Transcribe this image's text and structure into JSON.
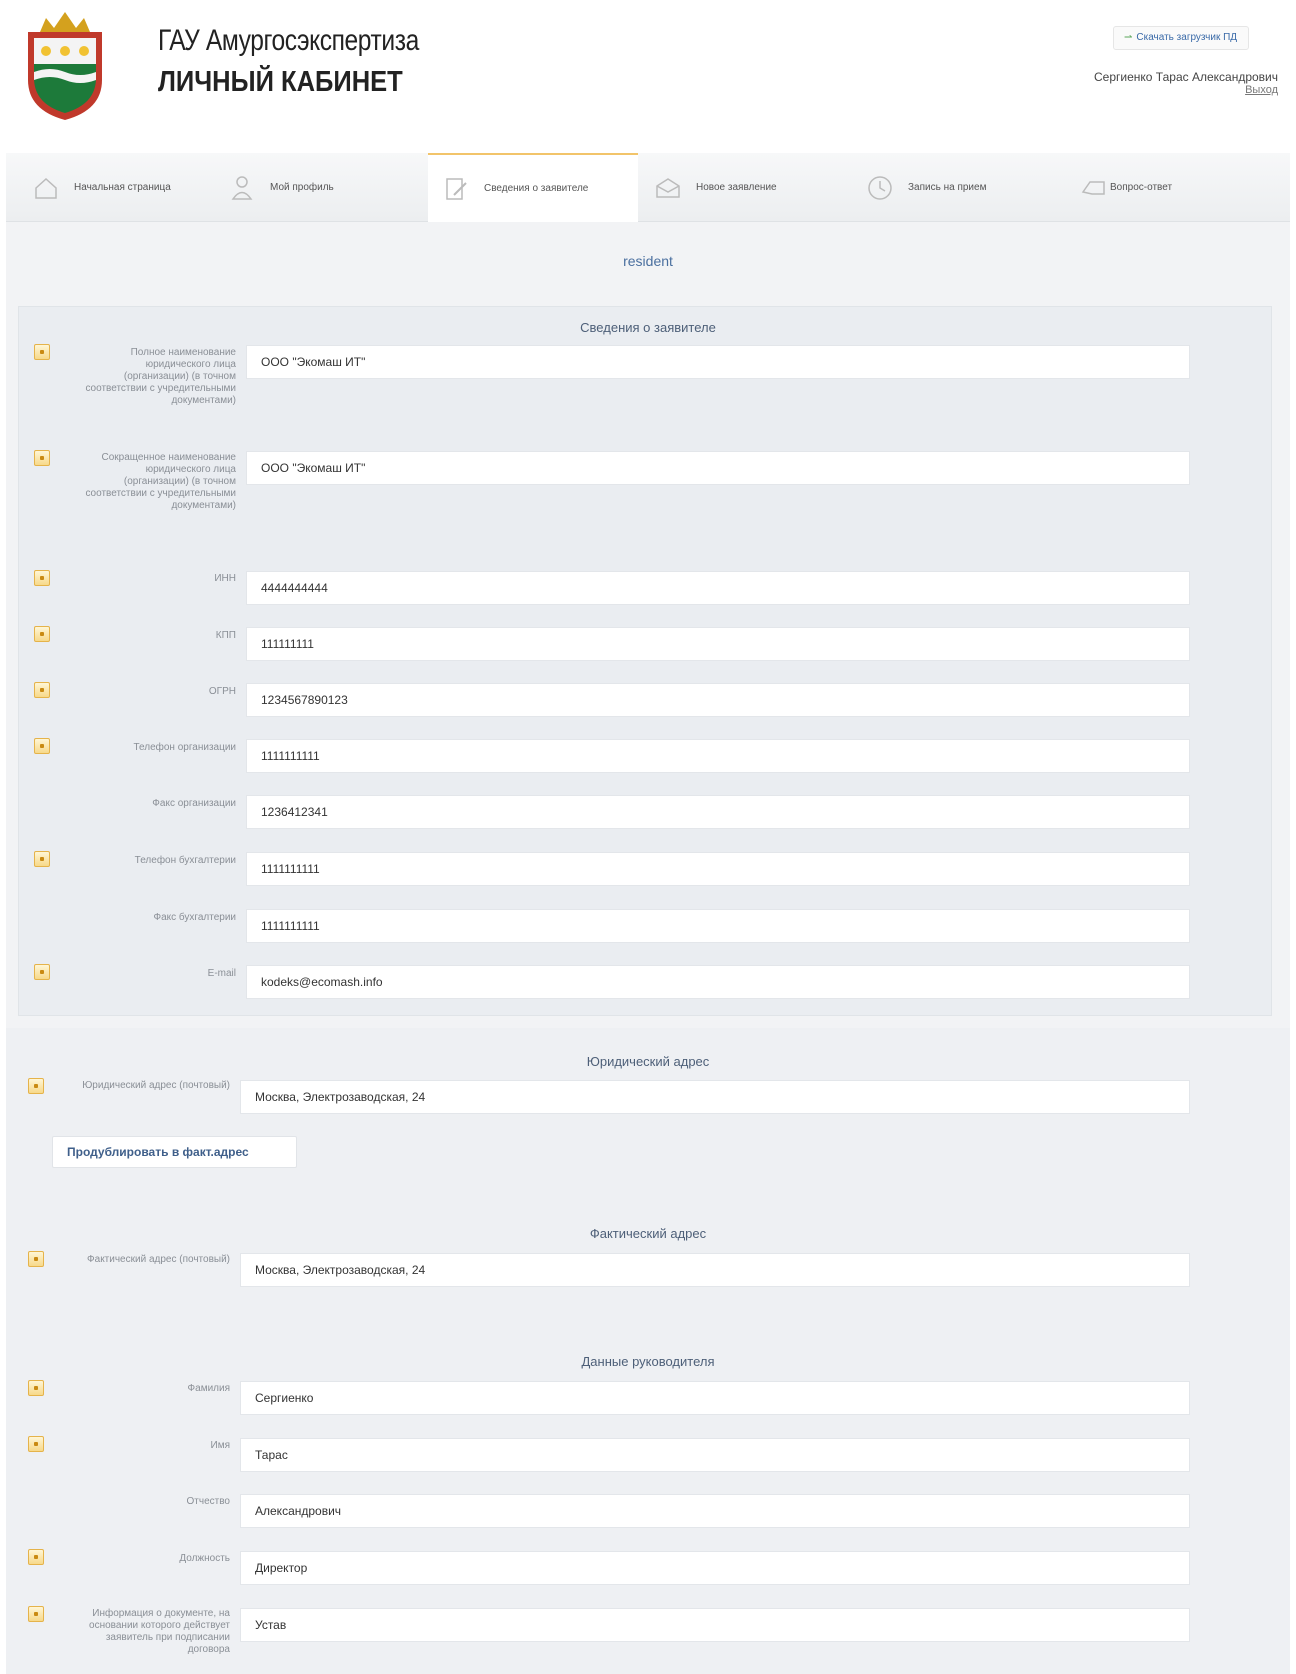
{
  "header": {
    "org_title": "ГАУ Амургосэкспертиза",
    "cabinet_title": "ЛИЧНЫЙ КАБИНЕТ",
    "download_button": "Скачать загрузчик ПД",
    "user_name": "Сергиенко Тарас Александрович",
    "logout_link": "Выход"
  },
  "nav": {
    "items": [
      {
        "label": "Начальная страница",
        "icon": "house-icon"
      },
      {
        "label": "Мой профиль",
        "icon": "user-icon"
      },
      {
        "label": "Сведения о заявителе",
        "icon": "edit-document-icon",
        "active": true
      },
      {
        "label": "Новое заявление",
        "icon": "envelope-icon"
      },
      {
        "label": "Запись на прием",
        "icon": "clock-icon"
      },
      {
        "label": "Вопрос-ответ",
        "icon": "chat-icon"
      }
    ]
  },
  "account_login": "resident",
  "applicant": {
    "section_title": "Сведения о заявителе",
    "fields": [
      {
        "label": "Полное наименование юридического лица (организации) (в точном соответствии с учредительными документами)",
        "value": "ООО \"Экомаш ИТ\"",
        "required": true
      },
      {
        "label": "Сокращенное наименование юридического лица (организации) (в точном соответствии с учредительными документами)",
        "value": "ООО \"Экомаш ИТ\"",
        "required": true
      },
      {
        "label": "ИНН",
        "value": "4444444444",
        "required": true
      },
      {
        "label": "КПП",
        "value": "111111111",
        "required": true
      },
      {
        "label": "ОГРН",
        "value": "1234567890123",
        "required": true
      },
      {
        "label": "Телефон организации",
        "value": "1111111111",
        "required": true
      },
      {
        "label": "Факс организации",
        "value": "1236412341",
        "required": false
      },
      {
        "label": "Телефон бухгалтерии",
        "value": "1111111111",
        "required": true
      },
      {
        "label": "Факс бухгалтерии",
        "value": "1111111111",
        "required": false
      },
      {
        "label": "E-mail",
        "value": "kodeks@ecomash.info",
        "required": true
      }
    ]
  },
  "legal_address": {
    "section_title": "Юридический адрес",
    "label": "Юридический адрес (почтовый)",
    "value": "Москва, Электрозаводская, 24",
    "duplicate_button": "Продублировать в факт.адрес"
  },
  "actual_address": {
    "section_title": "Фактический адрес",
    "label": "Фактический адрес (почтовый)",
    "value": "Москва, Электрозаводская, 24"
  },
  "director": {
    "section_title": "Данные руководителя",
    "fields": [
      {
        "label": "Фамилия",
        "value": "Сергиенко",
        "required": true
      },
      {
        "label": "Имя",
        "value": "Тарас",
        "required": true
      },
      {
        "label": "Отчество",
        "value": "Александрович",
        "required": false
      },
      {
        "label": "Должность",
        "value": "Директор",
        "required": true
      },
      {
        "label": "Информация о документе, на основании которого действует заявитель при подписании договора",
        "value": "Устав",
        "required": true
      }
    ]
  },
  "colors": {
    "accent_blue": "#3a6aa8",
    "required_marker": "#f7d98a",
    "active_tab_border": "#f2c46a"
  }
}
